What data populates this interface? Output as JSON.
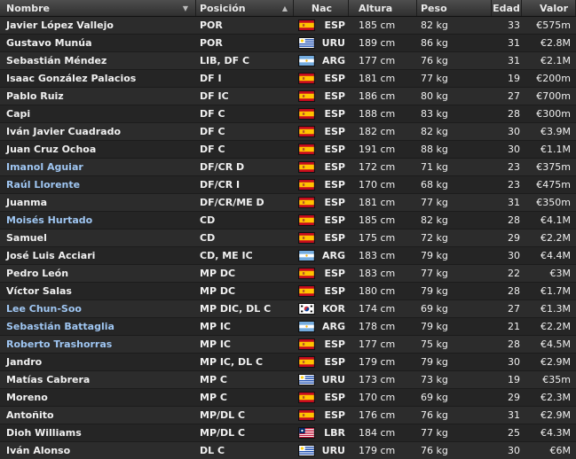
{
  "headers": {
    "name": "Nombre",
    "position": "Posición",
    "nationality": "Nac",
    "height": "Altura",
    "weight": "Peso",
    "age": "Edad",
    "value": "Valor",
    "sort_glyph": "▼",
    "sort_glyph_up": "▲"
  },
  "colors": {
    "loan_player": "#9fc6f2",
    "header_bg": "#3f3f3f",
    "row_bg": "#2c2c2c"
  },
  "players": [
    {
      "name": "Javier López Vallejo",
      "pos": "POR",
      "flag": "ESP",
      "nac": "ESP",
      "height": "185 cm",
      "weight": "82 kg",
      "age": "33",
      "value": "€575m",
      "loan": false
    },
    {
      "name": "Gustavo Munúa",
      "pos": "POR",
      "flag": "URU",
      "nac": "URU",
      "height": "189 cm",
      "weight": "86 kg",
      "age": "31",
      "value": "€2.8M",
      "loan": false
    },
    {
      "name": "Sebastián Méndez",
      "pos": "LIB, DF C",
      "flag": "ARG",
      "nac": "ARG",
      "height": "177 cm",
      "weight": "76 kg",
      "age": "31",
      "value": "€2.1M",
      "loan": false
    },
    {
      "name": "Isaac González Palacios",
      "pos": "DF I",
      "flag": "ESP",
      "nac": "ESP",
      "height": "181 cm",
      "weight": "77 kg",
      "age": "19",
      "value": "€200m",
      "loan": false
    },
    {
      "name": "Pablo Ruiz",
      "pos": "DF IC",
      "flag": "ESP",
      "nac": "ESP",
      "height": "186 cm",
      "weight": "80 kg",
      "age": "27",
      "value": "€700m",
      "loan": false
    },
    {
      "name": "Capi",
      "pos": "DF C",
      "flag": "ESP",
      "nac": "ESP",
      "height": "188 cm",
      "weight": "83 kg",
      "age": "28",
      "value": "€300m",
      "loan": false
    },
    {
      "name": "Iván Javier Cuadrado",
      "pos": "DF C",
      "flag": "ESP",
      "nac": "ESP",
      "height": "182 cm",
      "weight": "82 kg",
      "age": "30",
      "value": "€3.9M",
      "loan": false
    },
    {
      "name": "Juan Cruz Ochoa",
      "pos": "DF C",
      "flag": "ESP",
      "nac": "ESP",
      "height": "191 cm",
      "weight": "88 kg",
      "age": "30",
      "value": "€1.1M",
      "loan": false
    },
    {
      "name": "Imanol Aguiar",
      "pos": "DF/CR D",
      "flag": "ESP",
      "nac": "ESP",
      "height": "172 cm",
      "weight": "71 kg",
      "age": "23",
      "value": "€375m",
      "loan": true
    },
    {
      "name": "Raúl Llorente",
      "pos": "DF/CR I",
      "flag": "ESP",
      "nac": "ESP",
      "height": "170 cm",
      "weight": "68 kg",
      "age": "23",
      "value": "€475m",
      "loan": true
    },
    {
      "name": "Juanma",
      "pos": "DF/CR/ME D",
      "flag": "ESP",
      "nac": "ESP",
      "height": "181 cm",
      "weight": "77 kg",
      "age": "31",
      "value": "€350m",
      "loan": false
    },
    {
      "name": "Moisés Hurtado",
      "pos": "CD",
      "flag": "ESP",
      "nac": "ESP",
      "height": "185 cm",
      "weight": "82 kg",
      "age": "28",
      "value": "€4.1M",
      "loan": true
    },
    {
      "name": "Samuel",
      "pos": "CD",
      "flag": "ESP",
      "nac": "ESP",
      "height": "175 cm",
      "weight": "72 kg",
      "age": "29",
      "value": "€2.2M",
      "loan": false
    },
    {
      "name": "José Luis Acciari",
      "pos": "CD, ME IC",
      "flag": "ARG",
      "nac": "ARG",
      "height": "183 cm",
      "weight": "79 kg",
      "age": "30",
      "value": "€4.4M",
      "loan": false
    },
    {
      "name": "Pedro León",
      "pos": "MP DC",
      "flag": "ESP",
      "nac": "ESP",
      "height": "183 cm",
      "weight": "77 kg",
      "age": "22",
      "value": "€3M",
      "loan": false
    },
    {
      "name": "Víctor Salas",
      "pos": "MP DC",
      "flag": "ESP",
      "nac": "ESP",
      "height": "180 cm",
      "weight": "79 kg",
      "age": "28",
      "value": "€1.7M",
      "loan": false
    },
    {
      "name": "Lee Chun-Soo",
      "pos": "MP DIC, DL C",
      "flag": "KOR",
      "nac": "KOR",
      "height": "174 cm",
      "weight": "69 kg",
      "age": "27",
      "value": "€1.3M",
      "loan": true
    },
    {
      "name": "Sebastián Battaglia",
      "pos": "MP IC",
      "flag": "ARG",
      "nac": "ARG",
      "height": "178 cm",
      "weight": "79 kg",
      "age": "21",
      "value": "€2.2M",
      "loan": true
    },
    {
      "name": "Roberto Trashorras",
      "pos": "MP IC",
      "flag": "ESP",
      "nac": "ESP",
      "height": "177 cm",
      "weight": "75 kg",
      "age": "28",
      "value": "€4.5M",
      "loan": true
    },
    {
      "name": "Jandro",
      "pos": "MP IC, DL C",
      "flag": "ESP",
      "nac": "ESP",
      "height": "179 cm",
      "weight": "79 kg",
      "age": "30",
      "value": "€2.9M",
      "loan": false
    },
    {
      "name": "Matías Cabrera",
      "pos": "MP C",
      "flag": "URU",
      "nac": "URU",
      "height": "173 cm",
      "weight": "73 kg",
      "age": "19",
      "value": "€35m",
      "loan": false
    },
    {
      "name": "Moreno",
      "pos": "MP C",
      "flag": "ESP",
      "nac": "ESP",
      "height": "170 cm",
      "weight": "69 kg",
      "age": "29",
      "value": "€2.3M",
      "loan": false
    },
    {
      "name": "Antoñito",
      "pos": "MP/DL C",
      "flag": "ESP",
      "nac": "ESP",
      "height": "176 cm",
      "weight": "76 kg",
      "age": "31",
      "value": "€2.9M",
      "loan": false
    },
    {
      "name": "Dioh Williams",
      "pos": "MP/DL C",
      "flag": "LBR",
      "nac": "LBR",
      "height": "184 cm",
      "weight": "77 kg",
      "age": "25",
      "value": "€4.3M",
      "loan": false
    },
    {
      "name": "Iván Alonso",
      "pos": "DL C",
      "flag": "URU",
      "nac": "URU",
      "height": "179 cm",
      "weight": "76 kg",
      "age": "30",
      "value": "€6M",
      "loan": false
    }
  ]
}
